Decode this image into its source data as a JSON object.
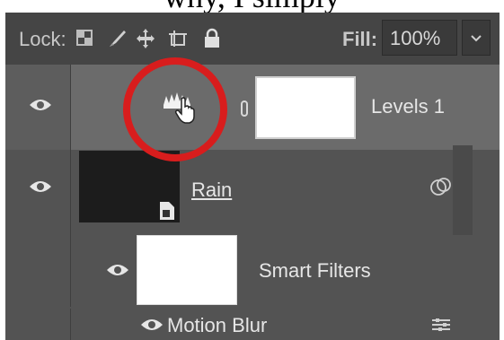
{
  "page_caption": "why, I simply",
  "lock_bar": {
    "lock_label": "Lock:",
    "lock_icons": [
      "lock-transparent-pixels-icon",
      "lock-image-pixels-icon",
      "lock-position-icon",
      "prevent-autonest-icon",
      "lock-all-icon"
    ],
    "fill_label": "Fill:",
    "fill_value": "100%"
  },
  "layers": {
    "levels": {
      "name": "Levels 1",
      "visible": true,
      "selected": true,
      "icon": "levels-adjustment-icon"
    },
    "rain": {
      "name": "Rain",
      "visible": true,
      "type": "smart-object"
    },
    "smart_filters": {
      "name": "Smart Filters",
      "visible": true
    },
    "motion_blur": {
      "name": "Motion Blur",
      "visible": true
    }
  },
  "colors": {
    "panel_bg": "#535353",
    "selected_row": "#6b6b6b",
    "highlight_circle": "#d81d1d"
  }
}
